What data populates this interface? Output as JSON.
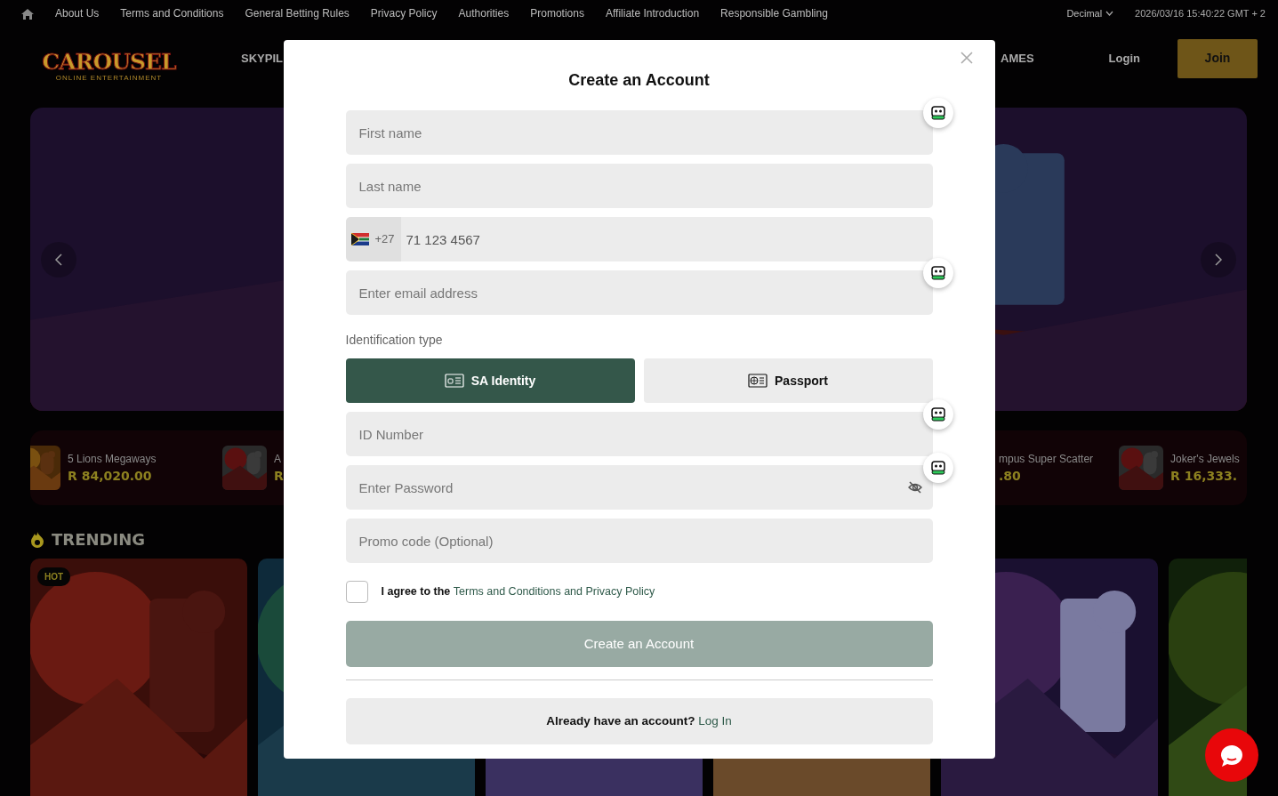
{
  "top_nav": {
    "links": [
      "About Us",
      "Terms and Conditions",
      "General Betting Rules",
      "Privacy Policy",
      "Authorities",
      "Promotions",
      "Affiliate Introduction",
      "Responsible Gambling"
    ],
    "odds_format": "Decimal",
    "datetime": "2026/03/16 15:40:22 GMT + 2"
  },
  "header": {
    "logo": "CAROUSEL",
    "logo_tagline": "ONLINE ENTERTAINMENT",
    "nav_left": "SKYPIL",
    "nav_right": "AMES",
    "login": "Login",
    "join": "Join"
  },
  "jackpots_left": [
    {
      "name": "5 Lions Megaways",
      "amount": "R 84,020.00"
    },
    {
      "name": "A",
      "amount": "R"
    }
  ],
  "jackpots_right": [
    {
      "name": "mpus Super Scatter",
      "amount": ".80"
    },
    {
      "name": "Joker's Jewels",
      "amount": "R 16,333."
    }
  ],
  "trending": {
    "title": "TRENDING",
    "badge": "HOT"
  },
  "modal": {
    "title": "Create an Account",
    "fields_top": [
      {
        "kind": "text",
        "placeholder": "First name",
        "autofill": true
      },
      {
        "kind": "text",
        "placeholder": "Last name",
        "autofill": false
      },
      {
        "kind": "phone",
        "dial_code": "+27",
        "value": "71 123 4567",
        "autofill": false
      },
      {
        "kind": "text",
        "placeholder": "Enter email address",
        "autofill": true
      }
    ],
    "id_label": "Identification type",
    "id_types": [
      {
        "kind": "id_card",
        "label": "SA Identity",
        "selected": true
      },
      {
        "kind": "passport",
        "label": "Passport",
        "selected": false
      }
    ],
    "fields_bottom": [
      {
        "kind": "text",
        "placeholder": "ID Number",
        "autofill": true
      },
      {
        "kind": "password",
        "placeholder": "Enter Password",
        "autofill": true
      },
      {
        "kind": "text",
        "placeholder": "Promo code (Optional)",
        "autofill": false
      }
    ],
    "agree": {
      "checked": false,
      "text": "I agree to the",
      "link": "Terms and Conditions and Privacy Policy"
    },
    "submit": {
      "label": "Create an Account",
      "disabled": true
    },
    "login_prompt": {
      "text": "Already have an account?",
      "link": "Log In"
    }
  }
}
